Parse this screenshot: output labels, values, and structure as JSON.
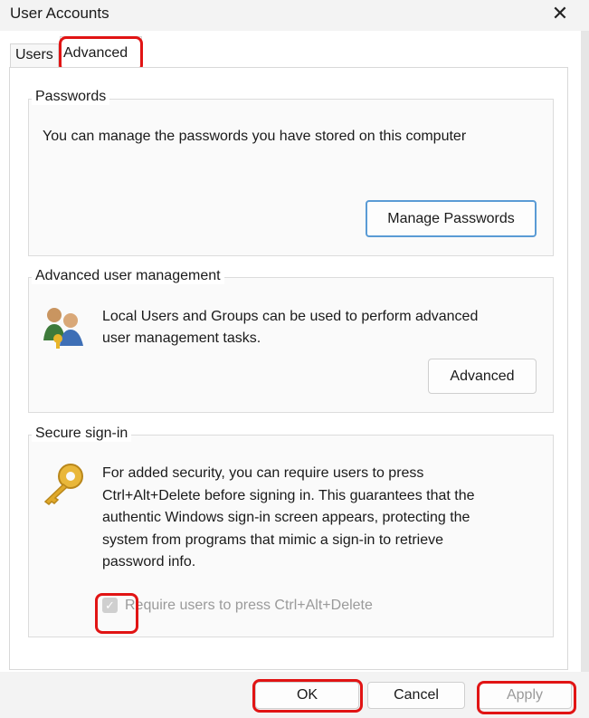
{
  "window": {
    "title": "User Accounts",
    "close_glyph": "✕"
  },
  "tabs": [
    {
      "label": "Users"
    },
    {
      "label": "Advanced",
      "selected": true
    }
  ],
  "passwords": {
    "heading": "Passwords",
    "description": "You can manage the passwords you have stored on this computer",
    "button": "Manage Passwords"
  },
  "advanced_management": {
    "heading": "Advanced user management",
    "line1": "Local Users and Groups can be used to perform advanced",
    "line2": "user management tasks.",
    "icon": "users-key-icon",
    "button": "Advanced"
  },
  "secure_signin": {
    "heading": "Secure sign-in",
    "icon": "key-icon",
    "lines": [
      "For added security, you can require users to press",
      "Ctrl+Alt+Delete before signing in. This guarantees that the",
      "authentic Windows sign-in screen appears, protecting the",
      "system from programs that mimic a sign-in to retrieve",
      "password info."
    ],
    "checkbox_label": "Require users to press Ctrl+Alt+Delete",
    "checkbox_checked": true
  },
  "footer": {
    "ok": "OK",
    "cancel": "Cancel",
    "apply": "Apply"
  },
  "colors": {
    "highlight": "#e11414",
    "accent_border": "#5a9bd5"
  }
}
